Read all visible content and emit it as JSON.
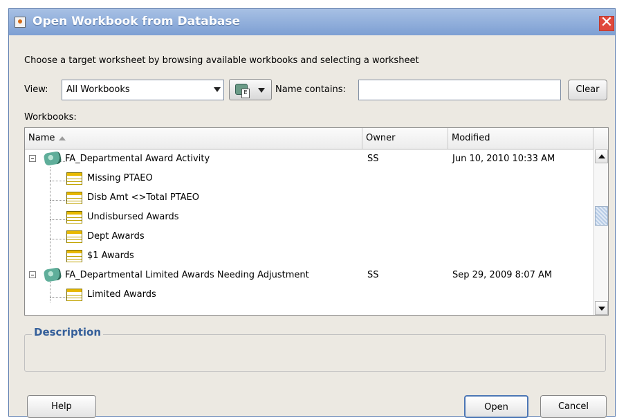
{
  "window": {
    "title": "Open Workbook from Database",
    "close_glyph": "✕"
  },
  "instruction": "Choose a target worksheet by browsing available workbooks and selecting a worksheet",
  "view": {
    "label": "View:",
    "selected": "All Workbooks"
  },
  "name_contains": {
    "label": "Name contains:",
    "value": ""
  },
  "buttons": {
    "clear": "Clear",
    "help": "Help",
    "open": "Open",
    "cancel": "Cancel"
  },
  "workbooks_label": "Workbooks:",
  "table": {
    "columns": [
      "Name",
      "Owner",
      "Modified"
    ],
    "rows": [
      {
        "name": "FA_Departmental Award Activity",
        "owner": "SS",
        "modified": "Jun 10, 2010 10:33 AM",
        "type": "workbook"
      },
      {
        "name": "Missing PTAEO",
        "type": "worksheet"
      },
      {
        "name": "Disb Amt <>Total PTAEO",
        "type": "worksheet"
      },
      {
        "name": "Undisbursed Awards",
        "type": "worksheet"
      },
      {
        "name": "Dept Awards",
        "type": "worksheet"
      },
      {
        "name": "$1 Awards",
        "type": "worksheet"
      },
      {
        "name": "FA_Departmental Limited Awards Needing Adjustment",
        "owner": "SS",
        "modified": "Sep 29, 2009 8:07 AM",
        "type": "workbook"
      },
      {
        "name": "Limited Awards",
        "type": "worksheet"
      }
    ]
  },
  "description": {
    "label": "Description"
  }
}
